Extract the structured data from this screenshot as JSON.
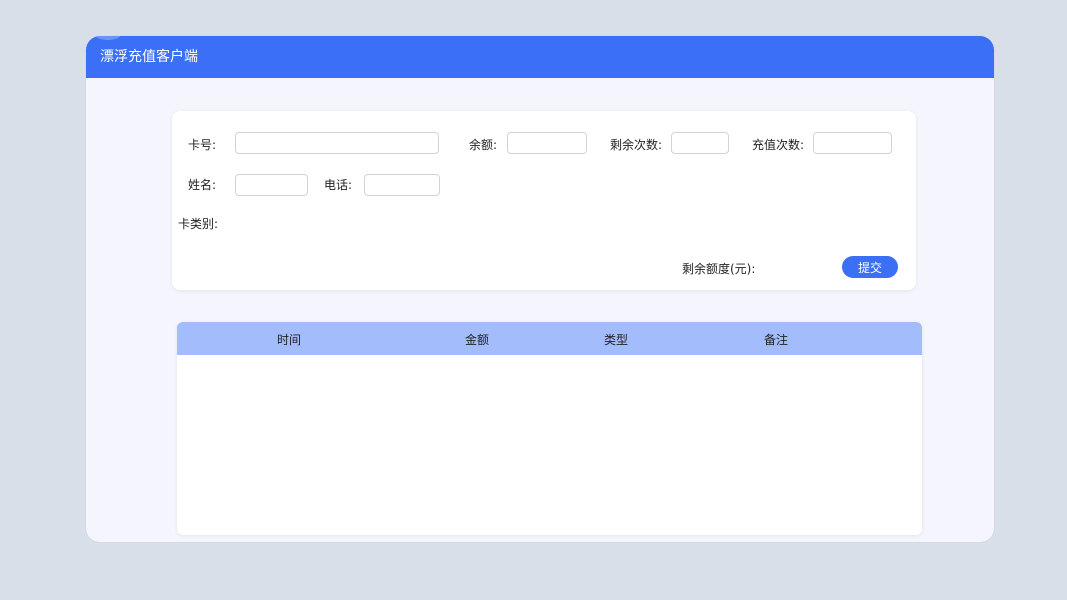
{
  "app": {
    "title": "漂浮充值客户端"
  },
  "form": {
    "card_no_label": "卡号:",
    "balance_label": "余额:",
    "remaining_times_label": "剩余次数:",
    "recharge_times_label": "充值次数:",
    "name_label": "姓名:",
    "phone_label": "电话:",
    "card_type_label": "卡类别:",
    "remaining_quota_label": "剩余额度(元):",
    "card_no_value": "",
    "balance_value": "",
    "remaining_times_value": "",
    "recharge_times_value": "",
    "name_value": "",
    "phone_value": "",
    "submit_label": "提交"
  },
  "table": {
    "columns": [
      "时间",
      "金额",
      "类型",
      "备注"
    ],
    "rows": []
  },
  "colors": {
    "accent": "#3b6ff5",
    "table_header": "#a3bcfb",
    "background": "#d8dfe8",
    "panel": "#f5f6fd"
  }
}
